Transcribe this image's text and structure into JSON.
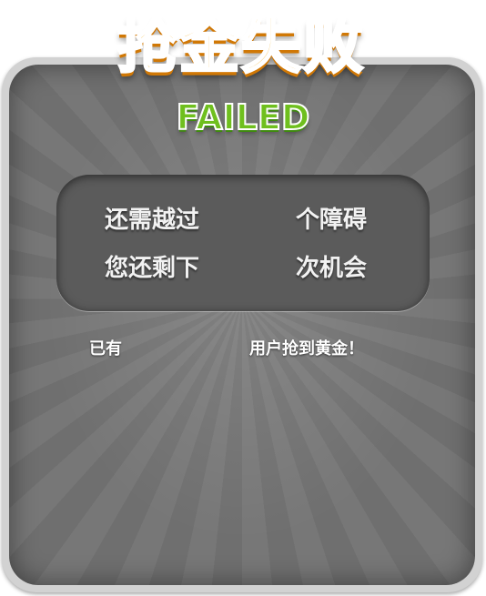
{
  "title": {
    "chinese": "抢金失败",
    "english": "FAILED"
  },
  "info": {
    "remaining_obstacles_prefix": "还需越过",
    "remaining_obstacles_suffix": "个障碍",
    "remaining_chances_prefix": "您还剩下",
    "remaining_chances_suffix": "次机会"
  },
  "footer": {
    "prefix": "已有",
    "suffix": "用户抢到黄金！"
  },
  "colors": {
    "title_orange": "#f2a50a",
    "failed_green": "#6fbf1e",
    "panel_gray": "#6f6f6f"
  }
}
